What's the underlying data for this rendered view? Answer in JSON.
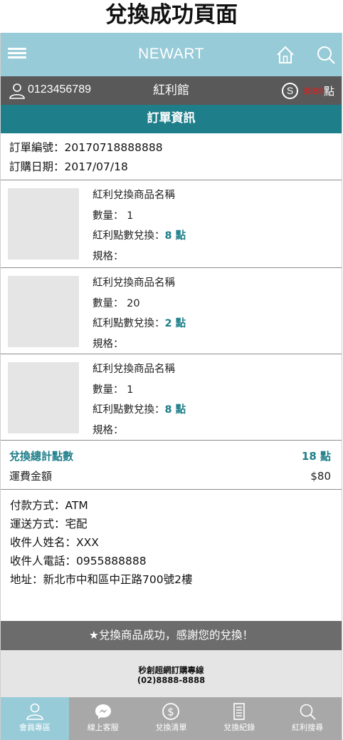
{
  "page_heading": "兌換成功頁面",
  "topbar": {
    "brand": "NEWART",
    "menu_icon": "hamburger-menu-icon",
    "home_icon": "home-icon",
    "search_icon": "search-icon"
  },
  "userbar": {
    "user_id": "0123456789",
    "hall": "紅利館",
    "coin_symbol": "S",
    "points_value": "8888",
    "points_unit": "點"
  },
  "section_title": "訂單資訊",
  "order": {
    "number": "訂單編號：20170718888888",
    "date": "訂購日期：2017/07/18"
  },
  "items": [
    {
      "name": "紅利兌換商品名稱",
      "qty_label": "數量：",
      "qty": "1",
      "points_label": "紅利點數兌換：",
      "points": "8 點",
      "spec_label": "規格："
    },
    {
      "name": "紅利兌換商品名稱",
      "qty_label": "數量：",
      "qty": "20",
      "points_label": "紅利點數兌換：",
      "points": "2 點",
      "spec_label": "規格："
    },
    {
      "name": "紅利兌換商品名稱",
      "qty_label": "數量：",
      "qty": "1",
      "points_label": "紅利點數兌換：",
      "points": "8 點",
      "spec_label": "規格："
    }
  ],
  "totals": {
    "points_label": "兌換總計點數",
    "points_value": "18 點",
    "shipping_label": "運費金額",
    "shipping_value": "$80"
  },
  "shipping_info": {
    "payment": "付款方式：ATM",
    "delivery": "運送方式：宅配",
    "recipient_name": "收件人姓名：XXX",
    "recipient_phone": "收件人電話：0955888888",
    "address": "地址：新北市中和區中正路700號2樓"
  },
  "success_message": "★兌換商品成功，感謝您的兌換！",
  "hotline": {
    "title": "秒創超網訂購專線",
    "phone": "(02)8888-8888"
  },
  "tabs": [
    {
      "label": "會員專區",
      "icon": "member-icon",
      "active": true
    },
    {
      "label": "線上客服",
      "icon": "messenger-icon",
      "active": false
    },
    {
      "label": "兌換清單",
      "icon": "dollar-coin-icon",
      "active": false
    },
    {
      "label": "兌換紀錄",
      "icon": "record-list-icon",
      "active": false
    },
    {
      "label": "紅利搜尋",
      "icon": "search-icon",
      "active": false
    }
  ],
  "colors": {
    "topbar": "#97cbd8",
    "accent": "#1e7e8a",
    "userbar": "#595959",
    "points_red": "#e11c1c"
  }
}
